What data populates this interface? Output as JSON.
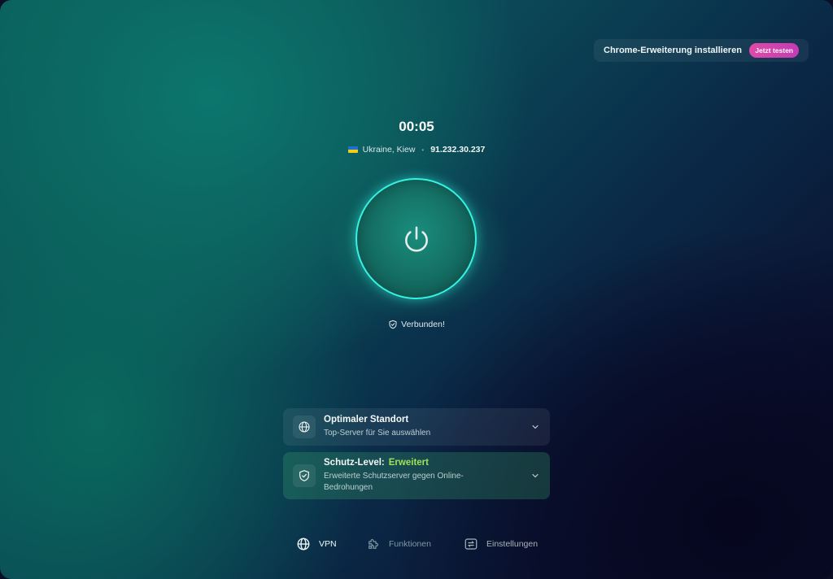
{
  "promo": {
    "text": "Chrome-Erweiterung installieren",
    "button": "Jetzt testen"
  },
  "session": {
    "timer": "00:05",
    "location": "Ukraine, Kiew",
    "separator": "•",
    "ip": "91.232.30.237"
  },
  "status": {
    "text": "Verbunden!"
  },
  "cards": [
    {
      "title": "Optimaler Standort",
      "subtitle": "Top-Server für Sie auswählen",
      "icon": "globe-icon"
    },
    {
      "title": "Schutz-Level:",
      "title_value": "Erweitert",
      "subtitle": "Erweiterte Schutzserver gegen Online-Bedrohungen",
      "icon": "shield-check-icon"
    }
  ],
  "nav": [
    {
      "label": "VPN",
      "icon": "globe-icon",
      "active": true
    },
    {
      "label": "Funktionen",
      "icon": "puzzle-icon",
      "active": false
    },
    {
      "label": "Einstellungen",
      "icon": "settings-toggle-icon",
      "active": false
    }
  ],
  "colors": {
    "accent_cyan": "#35f2e2",
    "accent_green": "#9fe35a",
    "promo_pink": "#e04aa8",
    "flag_blue": "#1f6fd1",
    "flag_yellow": "#f3cd16"
  }
}
